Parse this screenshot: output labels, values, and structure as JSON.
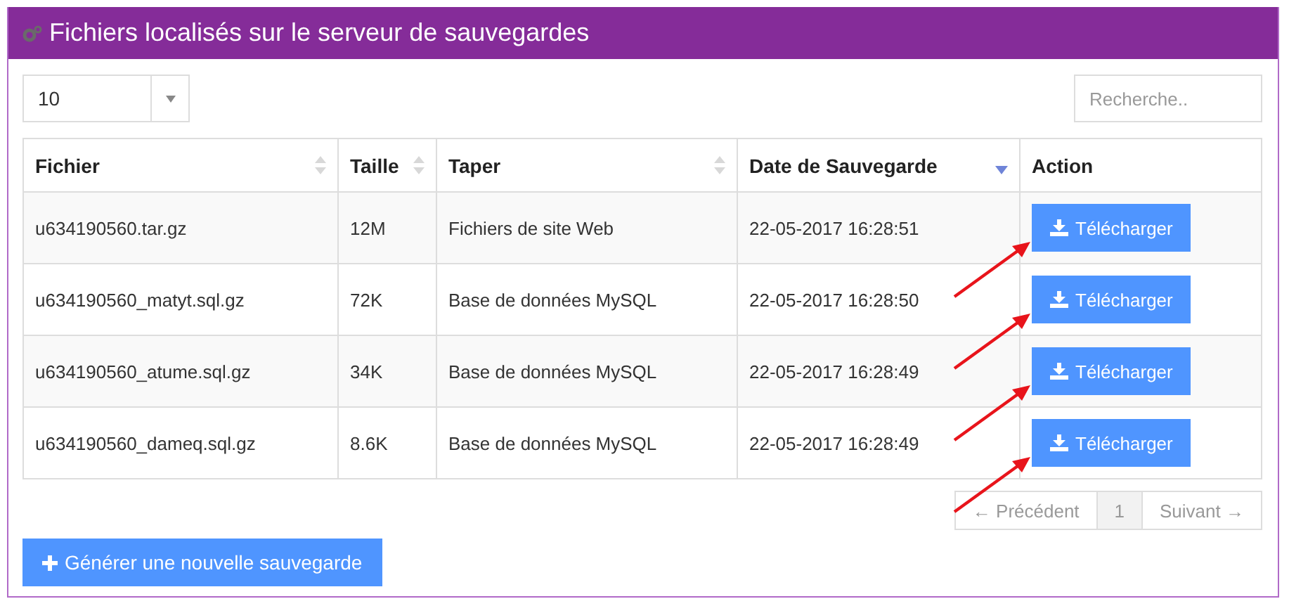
{
  "panel": {
    "title": "Fichiers localisés sur le serveur de sauvegardes"
  },
  "page_size": {
    "value": "10"
  },
  "search": {
    "placeholder": "Recherche.."
  },
  "table": {
    "columns": [
      {
        "label": "Fichier",
        "sortable": true,
        "sorted": false
      },
      {
        "label": "Taille",
        "sortable": true,
        "sorted": false
      },
      {
        "label": "Taper",
        "sortable": true,
        "sorted": false
      },
      {
        "label": "Date de Sauvegarde",
        "sortable": true,
        "sorted": true
      },
      {
        "label": "Action",
        "sortable": false
      }
    ],
    "rows": [
      {
        "file": "u634190560.tar.gz",
        "size": "12M",
        "type": "Fichiers de site Web",
        "date": "22-05-2017 16:28:51",
        "action": "Télécharger",
        "annotated": true
      },
      {
        "file": "u634190560_matyt.sql.gz",
        "size": "72K",
        "type": "Base de données MySQL",
        "date": "22-05-2017 16:28:50",
        "action": "Télécharger",
        "annotated": true
      },
      {
        "file": "u634190560_atume.sql.gz",
        "size": "34K",
        "type": "Base de données MySQL",
        "date": "22-05-2017 16:28:49",
        "action": "Télécharger",
        "annotated": true
      },
      {
        "file": "u634190560_dameq.sql.gz",
        "size": "8.6K",
        "type": "Base de données MySQL",
        "date": "22-05-2017 16:28:49",
        "action": "Télécharger",
        "annotated": true
      }
    ]
  },
  "pagination": {
    "previous": "← Précédent",
    "pages": [
      {
        "label": "1",
        "selected": true
      }
    ],
    "next": "Suivant →"
  },
  "generate_button": "Générer une nouvelle sauvegarde"
}
